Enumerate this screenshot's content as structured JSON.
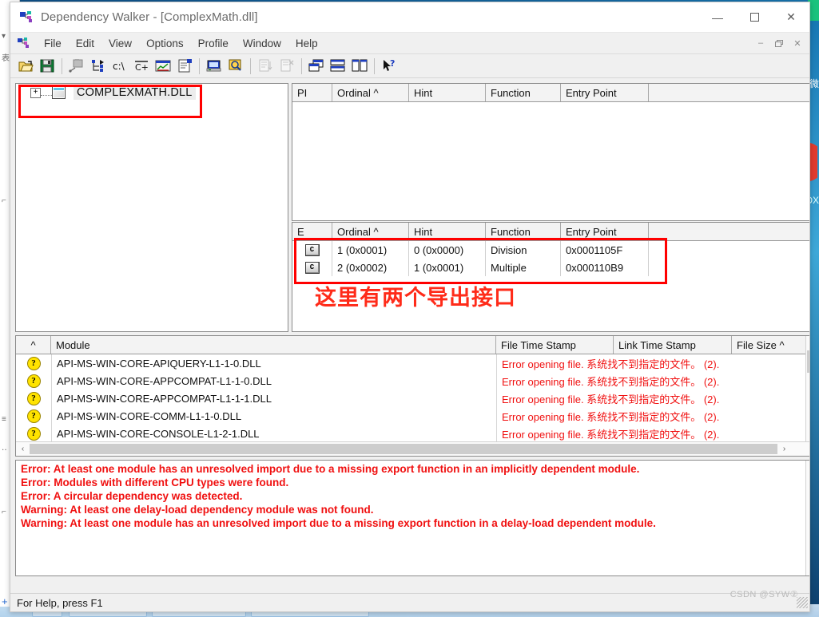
{
  "window": {
    "title": "Dependency Walker - [ComplexMath.dll]",
    "app_icon": "dependency-walker-icon",
    "controls": {
      "minimize": "—",
      "maximize": "☐",
      "close": "✕"
    },
    "mdi_controls": {
      "minimize": "–",
      "restore": "❐",
      "close": "✕"
    }
  },
  "menu": {
    "items": [
      "File",
      "Edit",
      "View",
      "Options",
      "Profile",
      "Window",
      "Help"
    ]
  },
  "toolbar": {
    "buttons": [
      {
        "name": "open-file-icon",
        "glyph": "open-folder"
      },
      {
        "name": "save-icon",
        "glyph": "floppy-disk"
      },
      {
        "name": "sep1",
        "glyph": "separator"
      },
      {
        "name": "autoexpand-icon",
        "glyph": "gray-box-arrow"
      },
      {
        "name": "expand-all-icon",
        "glyph": "tree-branch"
      },
      {
        "name": "full-paths-icon",
        "glyph": "c-drive"
      },
      {
        "name": "undecorate-cpp-icon",
        "glyph": "cpp"
      },
      {
        "name": "view-module-icon",
        "glyph": "chart-window"
      },
      {
        "name": "properties-icon",
        "glyph": "document-props"
      },
      {
        "name": "sep2",
        "glyph": "separator"
      },
      {
        "name": "system-info-icon",
        "glyph": "computer"
      },
      {
        "name": "search-icon",
        "glyph": "magnifier"
      },
      {
        "name": "sep3",
        "glyph": "separator"
      },
      {
        "name": "sort-list-icon",
        "glyph": "list-sort"
      },
      {
        "name": "clear-list-icon",
        "glyph": "list-clear"
      },
      {
        "name": "sep4",
        "glyph": "separator"
      },
      {
        "name": "arrange-windows-icon",
        "glyph": "cascade"
      },
      {
        "name": "tile-horizontal-icon",
        "glyph": "tile-h"
      },
      {
        "name": "tile-vertical-icon",
        "glyph": "tile-v"
      },
      {
        "name": "sep5",
        "glyph": "separator"
      },
      {
        "name": "context-help-icon",
        "glyph": "arrow-question"
      }
    ]
  },
  "tree": {
    "root": {
      "expander": "+",
      "icon": "module-icon",
      "label": "COMPLEXMATH.DLL"
    }
  },
  "import_list": {
    "columns": [
      "PI",
      "Ordinal ^",
      "Hint",
      "Function",
      "Entry Point",
      ""
    ],
    "rows": []
  },
  "export_list": {
    "columns": [
      "E",
      "Ordinal ^",
      "Hint",
      "Function",
      "Entry Point",
      ""
    ],
    "rows": [
      {
        "icon": "C",
        "ordinal": "1 (0x0001)",
        "hint": "0 (0x0000)",
        "function": "Division",
        "entry_point": "0x0001105F"
      },
      {
        "icon": "C",
        "ordinal": "2 (0x0002)",
        "hint": "1 (0x0001)",
        "function": "Multiple",
        "entry_point": "0x000110B9"
      }
    ]
  },
  "annotation": {
    "text": "这里有两个导出接口",
    "color": "#ff2b19"
  },
  "module_list": {
    "columns": [
      "^",
      "Module",
      "File Time Stamp",
      "Link Time Stamp",
      "File Size ^"
    ],
    "rows": [
      {
        "icon": "?",
        "module": "API-MS-WIN-CORE-APIQUERY-L1-1-0.DLL",
        "error": "Error opening file. 系统找不到指定的文件。  (2)."
      },
      {
        "icon": "?",
        "module": "API-MS-WIN-CORE-APPCOMPAT-L1-1-0.DLL",
        "error": "Error opening file. 系统找不到指定的文件。  (2)."
      },
      {
        "icon": "?",
        "module": "API-MS-WIN-CORE-APPCOMPAT-L1-1-1.DLL",
        "error": "Error opening file. 系统找不到指定的文件。  (2)."
      },
      {
        "icon": "?",
        "module": "API-MS-WIN-CORE-COMM-L1-1-0.DLL",
        "error": "Error opening file. 系统找不到指定的文件。  (2)."
      },
      {
        "icon": "?",
        "module": "API-MS-WIN-CORE-CONSOLE-L1-2-1.DLL",
        "error": "Error opening file. 系统找不到指定的文件。  (2)."
      }
    ]
  },
  "log": {
    "lines": [
      "Error: At least one module has an unresolved import due to a missing export function in an implicitly dependent module.",
      "Error: Modules with different CPU types were found.",
      "Error: A circular dependency was detected.",
      "Warning: At least one delay-load dependency module was not found.",
      "Warning: At least one module has an unresolved import due to a missing export function in a delay-load dependent module."
    ]
  },
  "statusbar": {
    "text": "For Help, press F1"
  },
  "watermark": {
    "text": "CSDN @SYW②"
  },
  "scroll": {
    "up_arrow": "∧",
    "down_arrow": "∨",
    "left_arrow": "‹",
    "right_arrow": "›"
  }
}
